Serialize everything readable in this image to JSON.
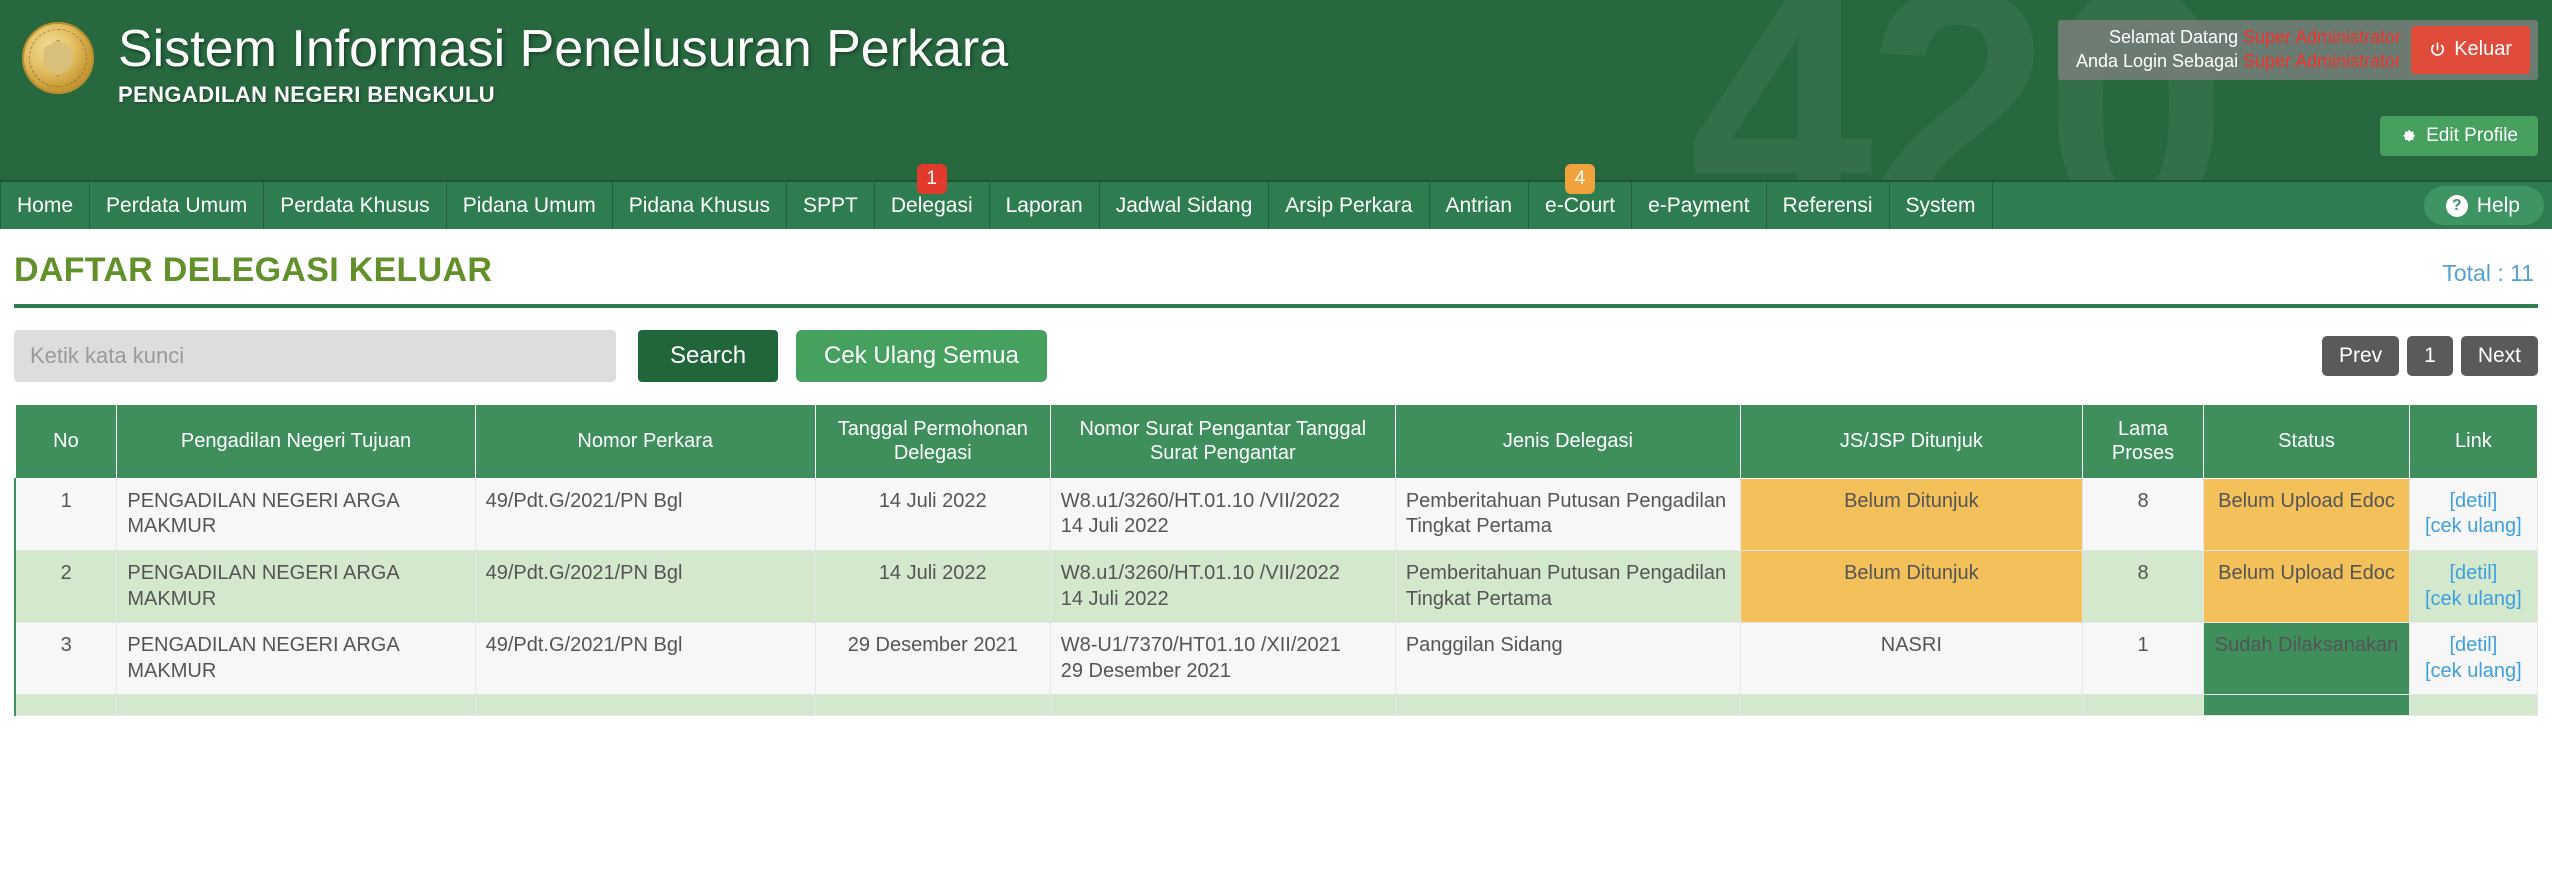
{
  "header": {
    "watermark": "420",
    "title": "Sistem Informasi Penelusuran Perkara",
    "subtitle": "PENGADILAN NEGERI BENGKULU",
    "logo_name": "court-seal-logo",
    "welcome_label": "Selamat Datang",
    "welcome_user": "Super Administrator",
    "role_label": "Anda Login Sebagai",
    "role_user": "Super Administrator",
    "logout_label": "Keluar",
    "edit_profile_label": "Edit Profile"
  },
  "nav": {
    "items": [
      {
        "label": "Home",
        "badge": null,
        "badge_color": null
      },
      {
        "label": "Perdata Umum",
        "badge": null,
        "badge_color": null
      },
      {
        "label": "Perdata Khusus",
        "badge": null,
        "badge_color": null
      },
      {
        "label": "Pidana Umum",
        "badge": null,
        "badge_color": null
      },
      {
        "label": "Pidana Khusus",
        "badge": null,
        "badge_color": null
      },
      {
        "label": "SPPT",
        "badge": null,
        "badge_color": null
      },
      {
        "label": "Delegasi",
        "badge": "1",
        "badge_color": "#e23b2e"
      },
      {
        "label": "Laporan",
        "badge": null,
        "badge_color": null
      },
      {
        "label": "Jadwal Sidang",
        "badge": null,
        "badge_color": null
      },
      {
        "label": "Arsip Perkara",
        "badge": null,
        "badge_color": null
      },
      {
        "label": "Antrian",
        "badge": null,
        "badge_color": null
      },
      {
        "label": "e-Court",
        "badge": "4",
        "badge_color": "#f0a33c"
      },
      {
        "label": "e-Payment",
        "badge": null,
        "badge_color": null
      },
      {
        "label": "Referensi",
        "badge": null,
        "badge_color": null
      },
      {
        "label": "System",
        "badge": null,
        "badge_color": null
      }
    ],
    "help_label": "Help"
  },
  "page": {
    "title": "DAFTAR DELEGASI KELUAR",
    "total_label": "Total : 11"
  },
  "toolbar": {
    "search_placeholder": "Ketik kata kunci",
    "search_value": "",
    "search_label": "Search",
    "cek_ulang_semua_label": "Cek Ulang Semua",
    "prev_label": "Prev",
    "page_number": "1",
    "next_label": "Next"
  },
  "table": {
    "columns": [
      "No",
      "Pengadilan Negeri Tujuan",
      "Nomor Perkara",
      "Tanggal Permohonan Delegasi",
      "Nomor Surat Pengantar Tanggal Surat Pengantar",
      "Jenis Delegasi",
      "JS/JSP Ditunjuk",
      "Lama Proses",
      "Status",
      "Link"
    ],
    "link_detail": "[detil]",
    "link_cek_ulang": "[cek ulang]",
    "rows": [
      {
        "no": "1",
        "pengadilan": "PENGADILAN NEGERI ARGA MAKMUR",
        "nomor_perkara": "49/Pdt.G/2021/PN Bgl",
        "tanggal_permohonan": "14 Juli 2022",
        "nomor_surat": "W8.u1/3260/HT.01.10 /VII/2022",
        "tanggal_surat": "14 Juli 2022",
        "jenis_delegasi": "Pemberitahuan Putusan Pengadilan Tingkat Pertama",
        "js_jsp": "Belum Ditunjuk",
        "js_jsp_style": "amber",
        "lama_proses": "8",
        "status": "Belum Upload Edoc",
        "status_style": "amber",
        "row_style": "odd"
      },
      {
        "no": "2",
        "pengadilan": "PENGADILAN NEGERI ARGA MAKMUR",
        "nomor_perkara": "49/Pdt.G/2021/PN Bgl",
        "tanggal_permohonan": "14 Juli 2022",
        "nomor_surat": "W8.u1/3260/HT.01.10 /VII/2022",
        "tanggal_surat": "14 Juli 2022",
        "jenis_delegasi": "Pemberitahuan Putusan Pengadilan Tingkat Pertama",
        "js_jsp": "Belum Ditunjuk",
        "js_jsp_style": "amber",
        "lama_proses": "8",
        "status": "Belum Upload Edoc",
        "status_style": "amber",
        "row_style": "even"
      },
      {
        "no": "3",
        "pengadilan": "PENGADILAN NEGERI ARGA MAKMUR",
        "nomor_perkara": "49/Pdt.G/2021/PN Bgl",
        "tanggal_permohonan": "29 Desember 2021",
        "nomor_surat": "W8-U1/7370/HT01.10 /XII/2021",
        "tanggal_surat": "29 Desember 2021",
        "jenis_delegasi": "Panggilan Sidang",
        "js_jsp": "NASRI",
        "js_jsp_style": "plain",
        "lama_proses": "1",
        "status": "Sudah Dilaksanakan",
        "status_style": "green",
        "row_style": "odd"
      },
      {
        "no": "",
        "pengadilan": "",
        "nomor_perkara": "",
        "tanggal_permohonan": "",
        "nomor_surat": "",
        "tanggal_surat": "",
        "jenis_delegasi": "",
        "js_jsp": "",
        "js_jsp_style": "plain",
        "lama_proses": "",
        "status": "",
        "status_style": "green",
        "row_style": "even"
      }
    ]
  }
}
